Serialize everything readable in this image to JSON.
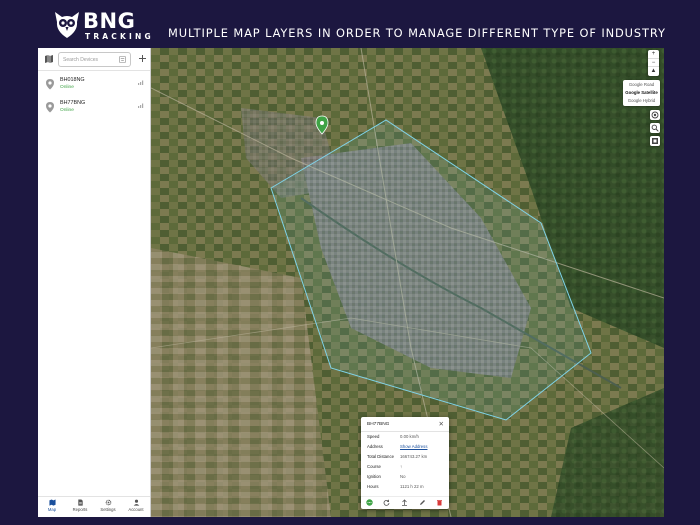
{
  "brand": {
    "name": "BNG",
    "subtitle": "TRACKING"
  },
  "headline": "MULTIPLE MAP LAYERS IN ORDER TO MANAGE DIFFERENT TYPE OF INDUSTRY",
  "sidebar": {
    "search": {
      "placeholder": "Search Devices"
    },
    "devices": [
      {
        "name": "BH018NG",
        "status": "Online"
      },
      {
        "name": "BH77BNG",
        "status": "Online"
      }
    ],
    "nav": [
      {
        "label": "Map",
        "icon": "map-icon"
      },
      {
        "label": "Reports",
        "icon": "reports-icon"
      },
      {
        "label": "Settings",
        "icon": "gear-icon"
      },
      {
        "label": "Account",
        "icon": "account-icon"
      }
    ]
  },
  "map": {
    "zoom_in": "+",
    "zoom_out": "−",
    "north": "▲",
    "layers": [
      "Google Road",
      "Google Satellite",
      "Google Hybrid"
    ],
    "selected_layer": "Google Satellite",
    "geofence_color": "#7fd3e8"
  },
  "popup": {
    "title": "BH77BNG",
    "close": "✕",
    "rows": [
      {
        "key": "Speed",
        "value": "0.00 km/h"
      },
      {
        "key": "Address",
        "value": "Show Address",
        "link": true
      },
      {
        "key": "Total Distance",
        "value": "166743.27 km"
      },
      {
        "key": "Course",
        "value": "↑"
      },
      {
        "key": "Ignition",
        "value": "No"
      },
      {
        "key": "Hours",
        "value": "1121 h 22 m"
      }
    ]
  },
  "colors": {
    "page_background": "#1c1740",
    "online": "#3fa346",
    "active_nav": "#1a4f9c",
    "pin_green": "#3fa346"
  }
}
